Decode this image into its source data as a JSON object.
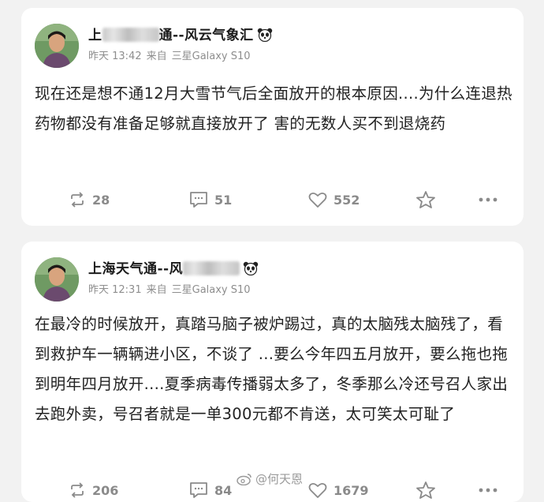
{
  "posts": [
    {
      "name_prefix": "上",
      "name_suffix": "通--风云气象汇",
      "time": "昨天 13:42",
      "source_prefix": "来自",
      "device": "三星Galaxy S10",
      "text": "现在还是想不通12月大雪节气后全面放开的根本原因....为什么连退热药物都没有准备足够就直接放开了 害的无数人买不到退烧药",
      "reposts": "28",
      "comments": "51",
      "likes": "552"
    },
    {
      "name_prefix": "上海天气通--风",
      "name_suffix": "",
      "time": "昨天 12:31",
      "source_prefix": "来自",
      "device": "三星Galaxy S10",
      "text": "在最冷的时候放开，真踏马脑子被炉踢过，真的太脑残太脑残了，看到救护车一辆辆进小区，不谈了 ...要么今年四五月放开，要么拖也拖到明年四月放开....夏季病毒传播弱太多了，冬季那么冷还号召人家出去跑外卖，号召者就是一单300元都不肯送，太可笑太可耻了",
      "reposts": "206",
      "comments": "84",
      "likes": "1679"
    }
  ],
  "watermark": "@何天恩",
  "icons": [
    "repost-icon",
    "comment-icon",
    "like-icon",
    "favorite-icon",
    "more-icon",
    "panda-icon"
  ],
  "colors": {
    "background": "#f2f2f2",
    "card": "#ffffff",
    "muted": "#8a8a8a"
  }
}
